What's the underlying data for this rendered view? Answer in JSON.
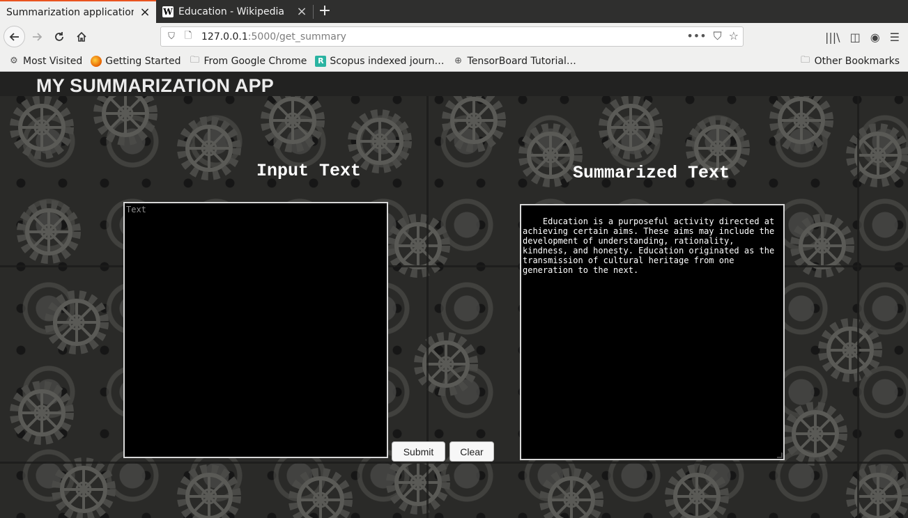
{
  "browser": {
    "tabs": [
      {
        "title": "Summarization application",
        "active": true
      },
      {
        "title": "Education - Wikipedia",
        "active": false
      }
    ],
    "url": {
      "host": "127.0.0.1",
      "rest": ":5000/get_summary"
    },
    "bookmarks": [
      {
        "label": "Most Visited",
        "icon": "gear-icon"
      },
      {
        "label": "Getting Started",
        "icon": "firefox-icon"
      },
      {
        "label": "From Google Chrome",
        "icon": "folder-icon"
      },
      {
        "label": "Scopus indexed journ…",
        "icon": "r-logo-icon"
      },
      {
        "label": "TensorBoard Tutorial…",
        "icon": "globe-icon"
      }
    ],
    "other_bookmarks": "Other Bookmarks"
  },
  "app": {
    "title": "MY SUMMARIZATION APP",
    "input_heading": "Input Text",
    "output_heading": "Summarized Text",
    "input_placeholder": "Text",
    "input_value": "",
    "summary": "Education is a purposeful activity directed at achieving certain aims. These aims may include the development of understanding, rationality, kindness, and honesty. Education originated as the transmission of cultural heritage from one generation to the next.",
    "submit_label": "Submit",
    "clear_label": "Clear"
  },
  "colors": {
    "accent_tab": "#e95420",
    "header_bg": "#222221",
    "textarea_bg": "#000000"
  }
}
